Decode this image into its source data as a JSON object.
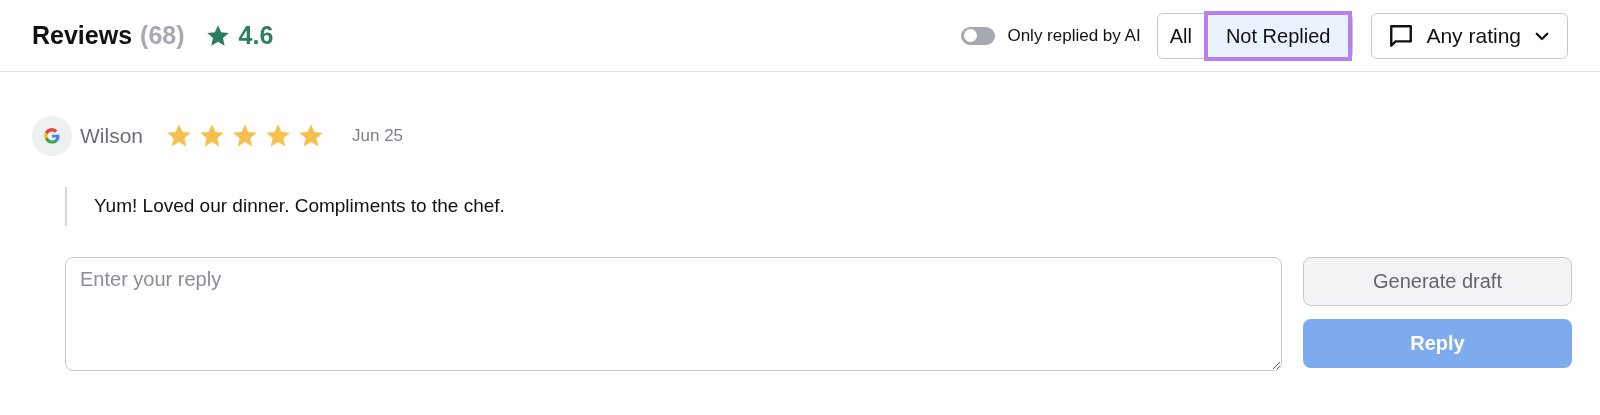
{
  "header": {
    "title": "Reviews",
    "count": "(68)",
    "rating": "4.6"
  },
  "ai_toggle": {
    "label": "Only replied by AI",
    "on": false
  },
  "filters": [
    {
      "label": "All",
      "selected": false
    },
    {
      "label": "Not Replied",
      "selected": true
    }
  ],
  "rating_filter": {
    "label": "Any rating"
  },
  "reviews": [
    {
      "author": "Wilson",
      "stars": 5,
      "date": "Jun 25",
      "text": "Yum! Loved our dinner. Compliments to the chef."
    }
  ],
  "reply_box": {
    "placeholder": "Enter your reply"
  },
  "buttons": [
    {
      "kind": "secondary",
      "label": "Generate draft",
      "disabled": false
    },
    {
      "kind": "primary",
      "label": "Reply",
      "disabled": true
    }
  ]
}
